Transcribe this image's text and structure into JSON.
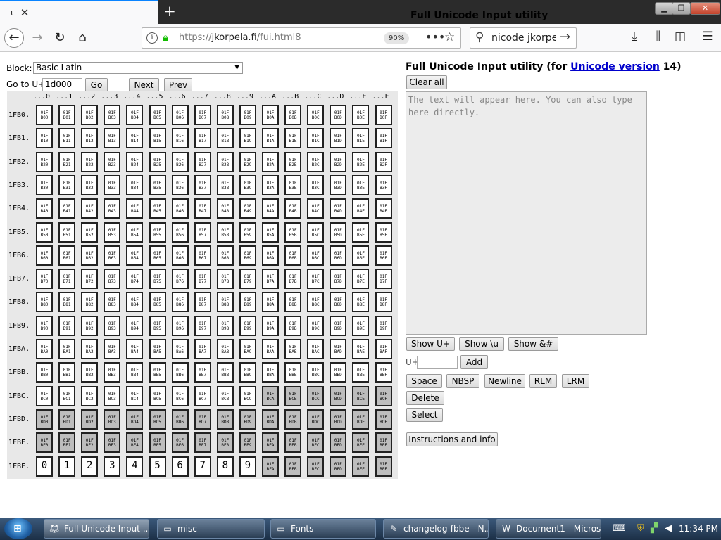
{
  "browser": {
    "tab_title": "Full Unicode Input utility",
    "tab_favicon": "hook-favicon-icon",
    "new_tab": "+",
    "window_controls": [
      "minimize-icon",
      "maximize-icon",
      "close-icon"
    ],
    "url_prefix": "https://",
    "url_host": "jkorpela.fi",
    "url_path": "/fui.html8",
    "zoom": "90%",
    "search_text": "nicode jkorpela"
  },
  "page": {
    "block_label": "Block:",
    "block_value": "Basic Latin",
    "goto_label": "Go to U+",
    "goto_value": "1d000",
    "go_button": "Go",
    "next_button": "Next",
    "prev_button": "Prev",
    "title_prefix": "Full Unicode Input utility (for ",
    "title_link": "Unicode version",
    "title_suffix": " 14)",
    "clear_all": "Clear all",
    "textarea_placeholder": "The text will appear here. You can also type here directly.",
    "show_uplus": "Show U+",
    "show_u": "Show \\u",
    "show_amp": "Show &#",
    "uplus_label": "U+",
    "add_button": "Add",
    "space_button": "Space",
    "nbsp_button": "NBSP",
    "newline_button": "Newline",
    "rlm_button": "RLM",
    "lrm_button": "LRM",
    "delete_button": "Delete",
    "select_button": "Select",
    "instructions_button": "Instructions and info"
  },
  "grid": {
    "column_headers": [
      "...0",
      "...1",
      "...2",
      "...3",
      "...4",
      "...5",
      "...6",
      "...7",
      "...8",
      "...9",
      "...A",
      "...B",
      "...C",
      "...D",
      "...E",
      "...F"
    ],
    "row_headers": [
      "1FB0.",
      "1FB1.",
      "1FB2.",
      "1FB3.",
      "1FB4.",
      "1FB5.",
      "1FB6.",
      "1FB7.",
      "1FB8.",
      "1FB9.",
      "1FBA.",
      "1FBB.",
      "1FBC.",
      "1FBD.",
      "1FBE.",
      "1FBF."
    ],
    "last_row_digits": [
      "0",
      "1",
      "2",
      "3",
      "4",
      "5",
      "6",
      "7",
      "8",
      "9"
    ]
  },
  "taskbar": {
    "tasks": [
      {
        "label": "Full Unicode Input ...",
        "icon": "firefox-icon"
      },
      {
        "label": "misc",
        "icon": "folder-icon"
      },
      {
        "label": "Fonts",
        "icon": "folder-icon"
      },
      {
        "label": "changelog-fbbe - N...",
        "icon": "notepad-icon"
      },
      {
        "label": "Document1 - Micros...",
        "icon": "word-icon"
      }
    ],
    "clock": "11:34 PM"
  },
  "colors": {
    "accent": "#0a84ff",
    "link": "#0000cc",
    "lock_green": "#12bc00",
    "grid_background": "#e8e8e8",
    "grey_cell": "#bdbdbd"
  }
}
